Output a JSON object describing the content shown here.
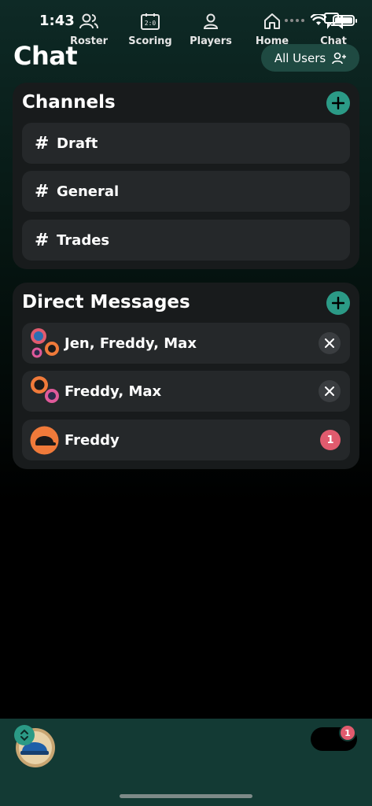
{
  "status_bar": {
    "time": "1:43"
  },
  "header": {
    "title": "Chat",
    "all_users_label": "All Users"
  },
  "channels": {
    "title": "Channels",
    "items": [
      {
        "hash": "#",
        "label": "Draft"
      },
      {
        "hash": "#",
        "label": "General"
      },
      {
        "hash": "#",
        "label": "Trades"
      }
    ]
  },
  "direct_messages": {
    "title": "Direct Messages",
    "items": [
      {
        "label": "Jen, Freddy, Max"
      },
      {
        "label": "Freddy, Max"
      },
      {
        "label": "Freddy",
        "unread": "1"
      }
    ]
  },
  "tab_bar": {
    "tabs": [
      {
        "label": "Roster",
        "icon": "roster-icon"
      },
      {
        "label": "Scoring",
        "icon": "scoreboard-icon"
      },
      {
        "label": "Players",
        "icon": "person-icon"
      },
      {
        "label": "Home",
        "icon": "home-icon"
      },
      {
        "label": "Chat",
        "icon": "chat-icon",
        "selected": true
      }
    ],
    "chat_badge": "1"
  },
  "colors": {
    "accent": "#2b9a86",
    "badge": "#e15b6e",
    "card": "#181b1c",
    "row": "#25282a",
    "tab_bar": "#133a34"
  }
}
